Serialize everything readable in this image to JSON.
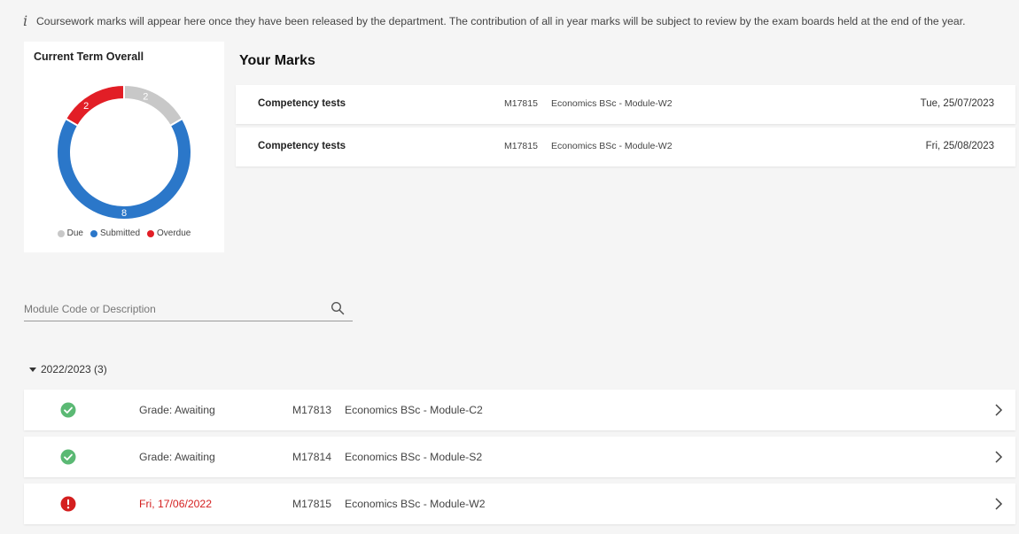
{
  "info": {
    "icon": "info-icon",
    "text": "Coursework marks will appear here once they have been released by the department. The contribution of all in year marks will be subject to review by the exam boards held at the end of the year."
  },
  "summary": {
    "title": "Current Term Overall",
    "chart_data": {
      "type": "pie",
      "categories": [
        "Due",
        "Submitted",
        "Overdue"
      ],
      "values": [
        2,
        8,
        2
      ],
      "colors": [
        "#c8c8c8",
        "#2b77c9",
        "#e21e26"
      ],
      "legend_position": "bottom"
    },
    "labels": {
      "due": "2",
      "submitted": "8",
      "overdue": "2"
    },
    "legend": [
      {
        "label": "Due",
        "color": "#c8c8c8"
      },
      {
        "label": "Submitted",
        "color": "#2b77c9"
      },
      {
        "label": "Overdue",
        "color": "#e21e26"
      }
    ]
  },
  "marks": {
    "title": "Your Marks",
    "rows": [
      {
        "name": "Competency tests",
        "code": "M17815",
        "module": "Economics BSc - Module-W2",
        "date": "Tue, 25/07/2023"
      },
      {
        "name": "Competency tests",
        "code": "M17815",
        "module": "Economics BSc - Module-W2",
        "date": "Fri, 25/08/2023"
      }
    ]
  },
  "search": {
    "placeholder": "Module Code or Description",
    "value": ""
  },
  "year_group": {
    "label": "2022/2023 (3)",
    "expanded": true,
    "modules": [
      {
        "status": "complete",
        "status_icon": "check-circle-icon",
        "grade": "Grade: Awaiting",
        "code": "M17813",
        "description": "Economics BSc - Module-C2"
      },
      {
        "status": "complete",
        "status_icon": "check-circle-icon",
        "grade": "Grade: Awaiting",
        "code": "M17814",
        "description": "Economics BSc - Module-S2"
      },
      {
        "status": "overdue",
        "status_icon": "alert-circle-icon",
        "grade": "Fri, 17/06/2022",
        "code": "M17815",
        "description": "Economics BSc - Module-W2"
      }
    ]
  },
  "colors": {
    "success": "#5bb974",
    "danger": "#d41f1f",
    "accent": "#2b77c9"
  }
}
